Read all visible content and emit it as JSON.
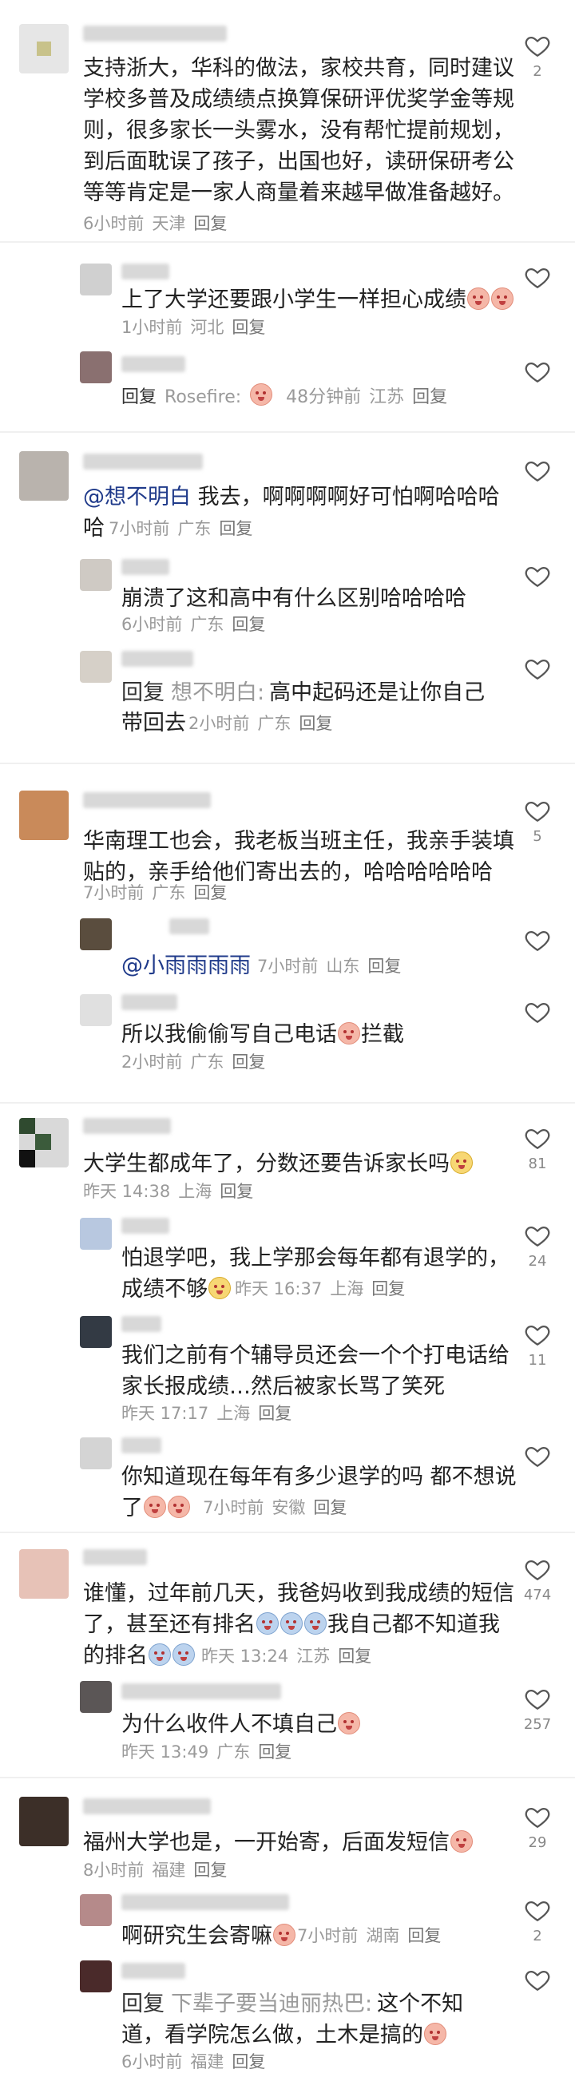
{
  "threads": [
    {
      "main": {
        "text_lines": [
          "支持浙大，华科的做法，家校共育，同时建议",
          "学校多普及成绩绩点换算保研评优奖学金等规",
          "则，很多家长一头雾水，没有帮忙提前规划，",
          "到后面耽误了孩子，出国也好，读研保研考公",
          "等等肯定是一家人商量着来越早做准备越好。"
        ],
        "time": "6小时前",
        "location": "天津",
        "reply": "回复",
        "likes": "2"
      },
      "replies": [
        {
          "text": "上了大学还要跟小学生一样担心成绩",
          "time": "1小时前",
          "location": "河北",
          "reply": "回复"
        },
        {
          "prefix": "回复",
          "target": "Rosefire:",
          "time": "48分钟前",
          "location": "江苏",
          "reply": "回复"
        }
      ]
    },
    {
      "main": {
        "text_lines": [
          "想不明白  我去，啊啊啊啊好可怕啊哈哈哈"
        ],
        "mention": "@想不明白",
        "text_after_mention": "  我去，啊啊啊啊好可怕啊哈哈哈",
        "line2": "哈",
        "time": "7小时前",
        "location": "广东",
        "reply": "回复",
        "likes": ""
      },
      "replies": [
        {
          "text": "崩溃了这和高中有什么区别哈哈哈哈",
          "time": "6小时前",
          "location": "广东",
          "reply": "回复"
        },
        {
          "prefix": "回复",
          "target": "想不明白:",
          "text": "高中起码还是让你自己",
          "line2": "带回去",
          "time": "2小时前",
          "location": "广东",
          "reply": "回复"
        }
      ]
    },
    {
      "main": {
        "text_lines": [
          "华南理工也会，我老板当班主任，我亲手装填",
          "贴的，亲手给他们寄出去的，哈哈哈哈哈哈"
        ],
        "time": "7小时前",
        "location": "广东",
        "reply": "回复",
        "likes": "5"
      },
      "replies": [
        {
          "mention": "@小雨雨雨雨",
          "time": "7小时前",
          "location": "山东",
          "reply": "回复"
        },
        {
          "text": "所以我偷偷写自己电话",
          "suffix": "拦截",
          "time": "2小时前",
          "location": "广东",
          "reply": "回复"
        }
      ]
    },
    {
      "main": {
        "text_lines": [
          "大学生都成年了，分数还要告诉家长吗"
        ],
        "time": "昨天 14:38",
        "location": "上海",
        "reply": "回复",
        "likes": "81"
      },
      "replies": [
        {
          "text": "怕退学吧，我上学那会每年都有退学的，",
          "line2": "成绩不够",
          "time": "昨天 16:37",
          "location": "上海",
          "reply": "回复",
          "likes": "24"
        },
        {
          "text": "我们之前有个辅导员还会一个个打电话给",
          "line2": "家长报成绩…然后被家长骂了笑死",
          "time": "昨天 17:17",
          "location": "上海",
          "reply": "回复",
          "likes": "11"
        },
        {
          "text": "你知道现在每年有多少退学的吗 都不想说",
          "line2": "了",
          "time": "7小时前",
          "location": "安徽",
          "reply": "回复"
        }
      ]
    },
    {
      "main": {
        "text_lines": [
          "谁懂，过年前几天，我爸妈收到我成绩的短信",
          "了，甚至还有排名",
          "我自己都不知道我",
          "的排名"
        ],
        "time": "昨天 13:24",
        "location": "江苏",
        "reply": "回复",
        "likes": "474"
      },
      "replies": [
        {
          "text": "为什么收件人不填自己",
          "time": "昨天 13:49",
          "location": "广东",
          "reply": "回复",
          "likes": "257"
        }
      ]
    },
    {
      "main": {
        "text_lines": [
          "福州大学也是，一开始寄，后面发短信"
        ],
        "time": "8小时前",
        "location": "福建",
        "reply": "回复",
        "likes": "29"
      },
      "replies": [
        {
          "text": "啊研究生会寄嘛",
          "time": "7小时前",
          "location": "湖南",
          "reply": "回复",
          "likes": "2"
        },
        {
          "prefix": "回复",
          "target": "下辈子要当迪丽热巴:",
          "text": "这个不知",
          "line2": "道，看学院怎么做，土木是搞的",
          "time": "6小时前",
          "location": "福建",
          "reply": "回复"
        }
      ]
    }
  ],
  "colors": {
    "accent": "#1f3a8a",
    "meta": "#9a9a9a"
  },
  "icons": {
    "like": "heart-outline-icon"
  }
}
